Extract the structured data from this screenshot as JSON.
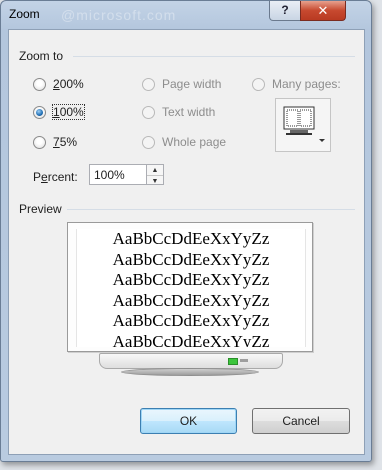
{
  "window": {
    "title": "Zoom",
    "blurred_title": "@microsoft.com",
    "help_label": "?",
    "close_label": "✕"
  },
  "zoom_to": {
    "label": "Zoom to",
    "options": [
      {
        "label": "200%",
        "hotkey_index": 0,
        "checked": false,
        "enabled": true
      },
      {
        "label": "100%",
        "hotkey_index": 0,
        "checked": true,
        "enabled": true
      },
      {
        "label": "75%",
        "hotkey_index": 0,
        "checked": false,
        "enabled": true
      },
      {
        "label": "Page width",
        "checked": false,
        "enabled": false
      },
      {
        "label": "Text width",
        "checked": false,
        "enabled": false
      },
      {
        "label": "Whole page",
        "checked": false,
        "enabled": false
      },
      {
        "label": "Many pages:",
        "checked": false,
        "enabled": false
      }
    ]
  },
  "percent": {
    "label": "Percent:",
    "value": "100%"
  },
  "preview": {
    "label": "Preview",
    "sample_lines": [
      "AaBbCcDdEeXxYyZz",
      "AaBbCcDdEeXxYyZz",
      "AaBbCcDdEeXxYyZz",
      "AaBbCcDdEeXxYyZz",
      "AaBbCcDdEeXxYyZz",
      "AaBbCcDdEeXxYyZz"
    ]
  },
  "buttons": {
    "ok": "OK",
    "cancel": "Cancel"
  },
  "colors": {
    "frame": "#b9cbe0",
    "close": "#c7492f",
    "radio_selected": "#1f6eb4"
  }
}
